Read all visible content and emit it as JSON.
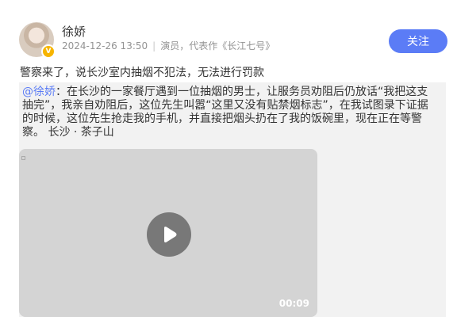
{
  "user": {
    "name": "徐娇",
    "timestamp": "2024-12-26 13:50",
    "description": "演员，代表作《长江七号》",
    "verified_badge": "V"
  },
  "follow_label": "关注",
  "post_text": "警察来了，说长沙室内抽烟不犯法，无法进行罚款",
  "repost": {
    "mention": "@徐娇",
    "text": "：在长沙的一家餐厅遇到一位抽烟的男士，让服务员劝阻后仍放话“我把这支抽完”，我亲自劝阻后，这位先生叫嚣“这里又没有贴禁烟标志”，在我试图录下证据的时候，这位先生抢走我的手机，并直接把烟头扔在了我的饭碗里，现在正在等警察。",
    "location": "长沙 · 茶子山",
    "video": {
      "duration": "00:09",
      "icon": "play-icon"
    }
  },
  "colors": {
    "accent": "#5b7cf6",
    "badge": "#f7b500",
    "repost_bg": "#f2f2f2",
    "video_bg": "#d4d4d4"
  }
}
